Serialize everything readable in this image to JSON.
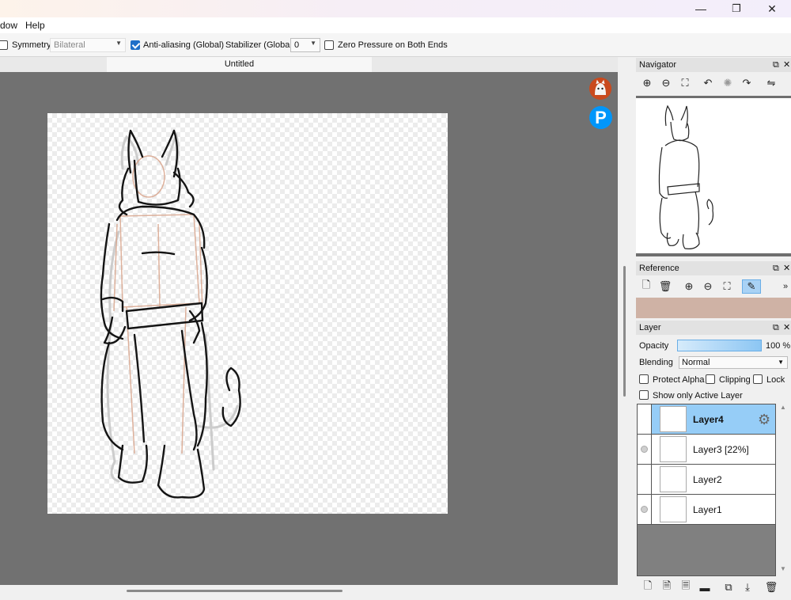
{
  "window": {
    "minimize_icon": "—",
    "restore_icon": "❐",
    "close_icon": "✕"
  },
  "menu": {
    "items": [
      "dow",
      "Help"
    ]
  },
  "toolbar": {
    "symmetry_label": "Symmetry",
    "symmetry_value": "Bilateral",
    "antialias_label": "Anti-aliasing (Global)",
    "stabilizer_label": "Stabilizer (Global)",
    "stabilizer_value": "0",
    "zero_pressure_label": "Zero Pressure on Both Ends"
  },
  "document": {
    "tab_title": "Untitled"
  },
  "colors": {
    "canvas_bg": "#717171",
    "accent": "#1f6fc8",
    "active_layer": "#96cdf7",
    "reference_swatch": "#cfb2a5",
    "pixiv": "#0096fa"
  },
  "navigator": {
    "title": "Navigator",
    "icons": [
      "zoom-in-icon",
      "zoom-out-icon",
      "fit-icon",
      "rotate-left-icon",
      "reset-rotation-icon",
      "rotate-right-icon",
      "flip-icon"
    ]
  },
  "reference": {
    "title": "Reference",
    "icons": [
      "new-icon",
      "delete-icon",
      "zoom-in-icon",
      "zoom-out-icon",
      "fit-icon",
      "eyedropper-icon",
      "more-icon"
    ]
  },
  "layer": {
    "title": "Layer",
    "opacity_label": "Opacity",
    "opacity_value": "100 %",
    "opacity_fraction": 1.0,
    "blending_label": "Blending",
    "blending_value": "Normal",
    "protect_alpha_label": "Protect Alpha",
    "clipping_label": "Clipping",
    "lock_label": "Lock",
    "show_only_active_label": "Show only Active Layer",
    "layers": [
      {
        "name": "Layer4",
        "active": true,
        "visible_marker": false
      },
      {
        "name": "Layer3 [22%]",
        "active": false,
        "visible_marker": true
      },
      {
        "name": "Layer2",
        "active": false,
        "visible_marker": false
      },
      {
        "name": "Layer1",
        "active": false,
        "visible_marker": true
      }
    ],
    "bottom_icons": [
      "new-layer-icon",
      "new-raster-icon",
      "new-vector-icon",
      "new-folder-icon",
      "duplicate-icon",
      "merge-down-icon",
      "delete-layer-icon"
    ]
  }
}
